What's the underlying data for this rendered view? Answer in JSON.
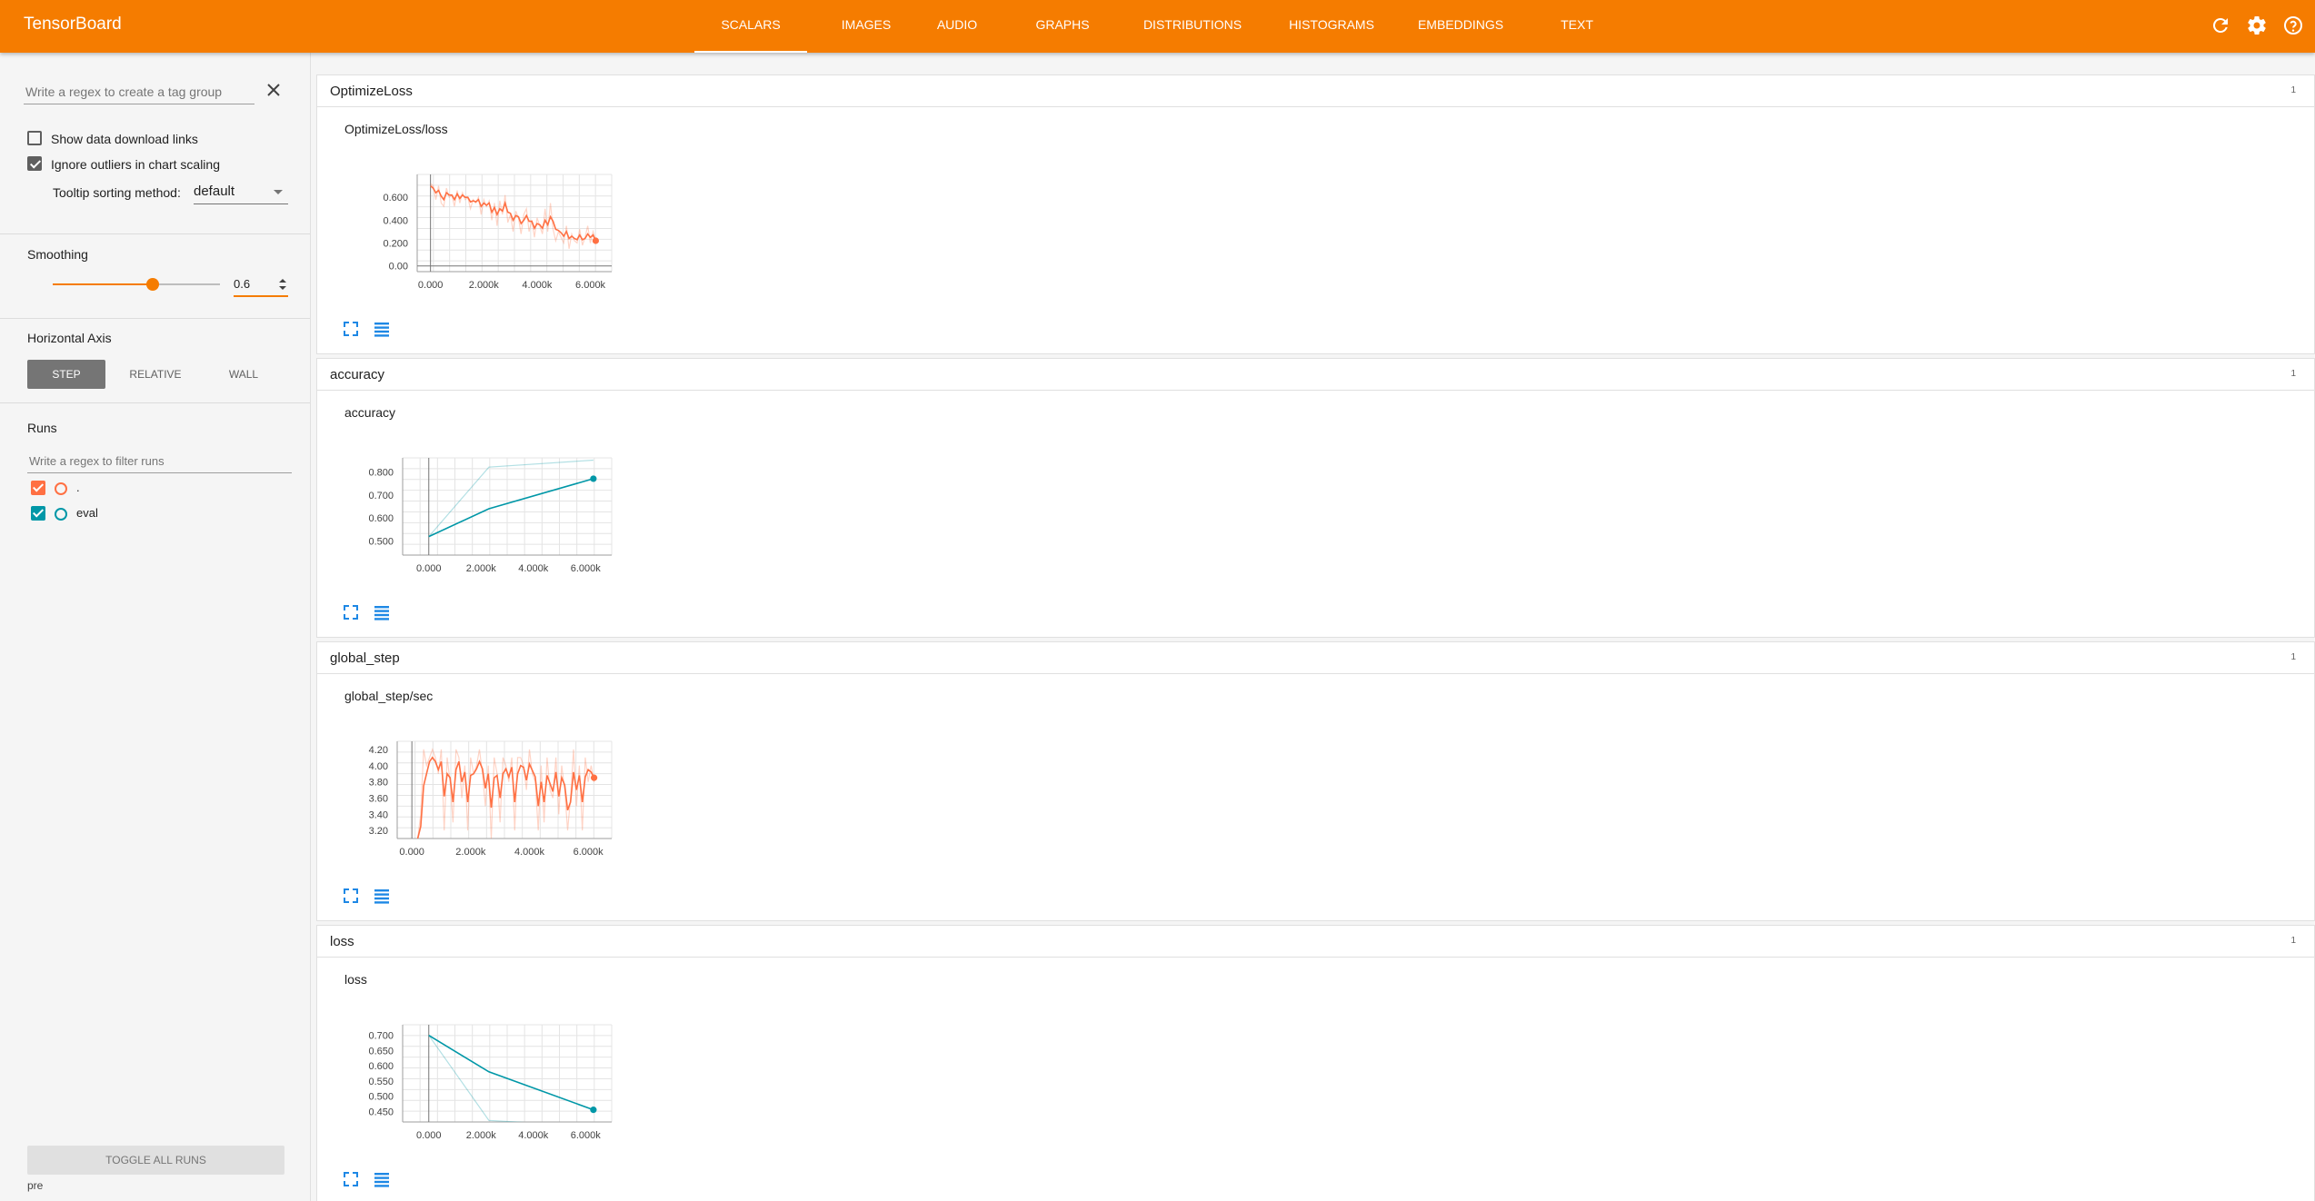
{
  "app": {
    "title": "TensorBoard"
  },
  "header": {
    "tabs": [
      {
        "label": "SCALARS",
        "active": true
      },
      {
        "label": "IMAGES",
        "active": false
      },
      {
        "label": "AUDIO",
        "active": false
      },
      {
        "label": "GRAPHS",
        "active": false
      },
      {
        "label": "DISTRIBUTIONS",
        "active": false
      },
      {
        "label": "HISTOGRAMS",
        "active": false
      },
      {
        "label": "EMBEDDINGS",
        "active": false
      },
      {
        "label": "TEXT",
        "active": false
      }
    ],
    "icons": [
      "refresh-icon",
      "settings-icon",
      "help-icon"
    ]
  },
  "sidebar": {
    "tag_regex_placeholder": "Write a regex to create a tag group",
    "show_download_links": {
      "label": "Show data download links",
      "checked": false
    },
    "ignore_outliers": {
      "label": "Ignore outliers in chart scaling",
      "checked": true
    },
    "tooltip_sorting": {
      "label": "Tooltip sorting method:",
      "value": "default"
    },
    "smoothing": {
      "title": "Smoothing",
      "value": "0.6",
      "level": 0.6
    },
    "horizontal_axis": {
      "title": "Horizontal Axis",
      "options": [
        {
          "label": "STEP",
          "selected": true
        },
        {
          "label": "RELATIVE",
          "selected": false
        },
        {
          "label": "WALL",
          "selected": false
        }
      ]
    },
    "runs": {
      "title": "Runs",
      "filter_placeholder": "Write a regex to filter runs",
      "items": [
        {
          "name": ".",
          "checked": true,
          "color": "#ff7043"
        },
        {
          "name": "eval",
          "checked": true,
          "color": "#0097a7"
        }
      ]
    },
    "toggle_all_label": "TOGGLE ALL RUNS",
    "footer_label": "pre"
  },
  "colors": {
    "accent": "#f57c00",
    "train": "#ff7043",
    "eval": "#0097a7"
  },
  "groups": [
    {
      "title": "OptimizeLoss",
      "count": "1",
      "card_title": "OptimizeLoss/loss"
    },
    {
      "title": "accuracy",
      "count": "1",
      "card_title": "accuracy"
    },
    {
      "title": "global_step",
      "count": "1",
      "card_title": "global_step/sec"
    },
    {
      "title": "loss",
      "count": "1",
      "card_title": "loss"
    }
  ],
  "chart_data": [
    {
      "type": "line",
      "title": "OptimizeLoss/loss",
      "xlim": [
        -500,
        6800
      ],
      "ylim": [
        -0.05,
        0.8
      ],
      "xticks": [
        0,
        2000,
        4000,
        6000
      ],
      "xtick_labels": [
        "0.000",
        "2.000k",
        "4.000k",
        "6.000k"
      ],
      "yticks": [
        0.0,
        0.2,
        0.4,
        0.6
      ],
      "ytick_labels": [
        "0.00",
        "0.200",
        "0.400",
        "0.600"
      ],
      "series": [
        {
          "color": "#ff7043",
          "x": [
            0,
            100,
            200,
            300,
            400,
            500,
            600,
            700,
            800,
            900,
            1000,
            1100,
            1200,
            1300,
            1400,
            1500,
            1600,
            1700,
            1800,
            1900,
            2000,
            2100,
            2200,
            2300,
            2400,
            2500,
            2600,
            2700,
            2800,
            2900,
            3000,
            3100,
            3200,
            3300,
            3400,
            3500,
            3600,
            3700,
            3800,
            3900,
            4000,
            4100,
            4200,
            4300,
            4400,
            4500,
            4600,
            4700,
            4800,
            4900,
            5000,
            5100,
            5200,
            5300,
            5400,
            5500,
            5600,
            5700,
            5800,
            5900,
            6000,
            6100,
            6200
          ],
          "raw": [
            0.72,
            0.7,
            0.58,
            0.7,
            0.55,
            0.52,
            0.68,
            0.6,
            0.62,
            0.52,
            0.66,
            0.55,
            0.64,
            0.58,
            0.6,
            0.5,
            0.58,
            0.55,
            0.6,
            0.45,
            0.58,
            0.52,
            0.57,
            0.4,
            0.55,
            0.35,
            0.57,
            0.45,
            0.62,
            0.38,
            0.45,
            0.3,
            0.48,
            0.42,
            0.28,
            0.45,
            0.5,
            0.3,
            0.4,
            0.25,
            0.42,
            0.35,
            0.28,
            0.5,
            0.3,
            0.55,
            0.32,
            0.22,
            0.3,
            0.25,
            0.2,
            0.35,
            0.15,
            0.28,
            0.22,
            0.2,
            0.32,
            0.18,
            0.25,
            0.35,
            0.2,
            0.3,
            0.22
          ],
          "smoothed": [
            0.7,
            0.68,
            0.64,
            0.66,
            0.61,
            0.58,
            0.64,
            0.62,
            0.62,
            0.58,
            0.63,
            0.59,
            0.62,
            0.6,
            0.6,
            0.56,
            0.57,
            0.56,
            0.58,
            0.52,
            0.55,
            0.53,
            0.55,
            0.47,
            0.51,
            0.45,
            0.5,
            0.48,
            0.55,
            0.47,
            0.46,
            0.4,
            0.44,
            0.43,
            0.37,
            0.4,
            0.44,
            0.39,
            0.39,
            0.33,
            0.37,
            0.36,
            0.33,
            0.4,
            0.36,
            0.43,
            0.39,
            0.32,
            0.31,
            0.29,
            0.26,
            0.3,
            0.24,
            0.26,
            0.24,
            0.23,
            0.27,
            0.23,
            0.24,
            0.28,
            0.25,
            0.27,
            0.22
          ]
        }
      ]
    },
    {
      "type": "line",
      "title": "accuracy",
      "xlim": [
        -1000,
        7000
      ],
      "ylim": [
        0.44,
        0.86
      ],
      "xticks": [
        0,
        2000,
        4000,
        6000
      ],
      "xtick_labels": [
        "0.000",
        "2.000k",
        "4.000k",
        "6.000k"
      ],
      "yticks": [
        0.5,
        0.6,
        0.7,
        0.8
      ],
      "ytick_labels": [
        "0.500",
        "0.600",
        "0.700",
        "0.800"
      ],
      "series": [
        {
          "color": "#0097a7",
          "x": [
            0,
            2300,
            6300
          ],
          "raw": [
            0.52,
            0.82,
            0.85
          ],
          "smoothed": [
            0.52,
            0.64,
            0.77
          ]
        }
      ]
    },
    {
      "type": "line",
      "title": "global_step/sec",
      "xlim": [
        -500,
        6800
      ],
      "ylim": [
        3.1,
        4.3
      ],
      "xticks": [
        0,
        2000,
        4000,
        6000
      ],
      "xtick_labels": [
        "0.000",
        "2.000k",
        "4.000k",
        "6.000k"
      ],
      "yticks": [
        3.2,
        3.4,
        3.6,
        3.8,
        4.0,
        4.2
      ],
      "ytick_labels": [
        "3.20",
        "3.40",
        "3.60",
        "3.80",
        "4.00",
        "4.20"
      ],
      "series": [
        {
          "color": "#ff7043",
          "x": [
            200,
            300,
            400,
            500,
            600,
            700,
            800,
            900,
            1000,
            1100,
            1200,
            1300,
            1400,
            1500,
            1600,
            1700,
            1800,
            1900,
            2000,
            2100,
            2200,
            2300,
            2400,
            2500,
            2600,
            2700,
            2800,
            2900,
            3000,
            3100,
            3200,
            3300,
            3400,
            3500,
            3600,
            3700,
            3800,
            3900,
            4000,
            4100,
            4200,
            4300,
            4400,
            4500,
            4600,
            4700,
            4800,
            4900,
            5000,
            5100,
            5200,
            5300,
            5400,
            5500,
            5600,
            5700,
            5800,
            5900,
            6000,
            6100,
            6200
          ],
          "raw": [
            3.1,
            3.4,
            4.2,
            4.0,
            4.1,
            4.2,
            4.1,
            3.9,
            4.2,
            3.2,
            4.1,
            3.8,
            3.3,
            4.2,
            4.1,
            3.6,
            4.0,
            3.2,
            4.1,
            3.9,
            4.0,
            4.2,
            3.9,
            3.5,
            4.0,
            3.1,
            4.1,
            3.9,
            3.3,
            4.1,
            4.0,
            3.8,
            4.1,
            3.2,
            4.1,
            4.1,
            4.0,
            3.7,
            4.2,
            3.9,
            3.8,
            3.2,
            4.0,
            3.3,
            4.1,
            3.7,
            3.6,
            4.1,
            3.4,
            4.0,
            3.7,
            3.2,
            3.6,
            4.2,
            3.5,
            4.0,
            3.2,
            4.1,
            3.8,
            4.0,
            3.8
          ],
          "smoothed": [
            3.1,
            3.25,
            3.75,
            3.9,
            4.05,
            4.1,
            4.05,
            3.95,
            4.05,
            3.62,
            3.9,
            3.85,
            3.55,
            3.95,
            4.05,
            3.8,
            3.92,
            3.55,
            3.88,
            3.9,
            3.96,
            4.05,
            3.96,
            3.72,
            3.9,
            3.48,
            3.85,
            3.88,
            3.6,
            3.9,
            3.96,
            3.86,
            3.98,
            3.55,
            3.9,
            4.0,
            3.98,
            3.82,
            4.02,
            3.94,
            3.86,
            3.5,
            3.8,
            3.55,
            3.88,
            3.78,
            3.68,
            3.92,
            3.62,
            3.85,
            3.76,
            3.45,
            3.55,
            3.92,
            3.7,
            3.88,
            3.55,
            3.86,
            3.95,
            3.92,
            3.85
          ]
        }
      ]
    },
    {
      "type": "line",
      "title": "loss",
      "xlim": [
        -1000,
        7000
      ],
      "ylim": [
        0.415,
        0.735
      ],
      "xticks": [
        0,
        2000,
        4000,
        6000
      ],
      "xtick_labels": [
        "0.000",
        "2.000k",
        "4.000k",
        "6.000k"
      ],
      "yticks": [
        0.45,
        0.5,
        0.55,
        0.6,
        0.65,
        0.7
      ],
      "ytick_labels": [
        "0.450",
        "0.500",
        "0.550",
        "0.600",
        "0.650",
        "0.700"
      ],
      "series": [
        {
          "color": "#0097a7",
          "x": [
            0,
            2300,
            6300
          ],
          "raw": [
            0.7,
            0.42,
            0.4
          ],
          "smoothed": [
            0.7,
            0.58,
            0.455
          ]
        }
      ]
    }
  ]
}
